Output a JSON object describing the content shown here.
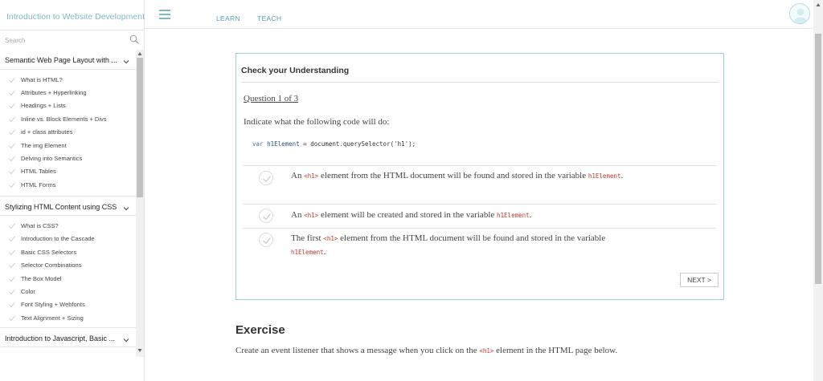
{
  "sidebar": {
    "course_title": "Introduction to Website Development",
    "search_placeholder": "Search",
    "sections": [
      {
        "title": "Semantic Web Page Layout with ...",
        "items": [
          "What is HTML?",
          "Attributes + Hyperlinking",
          "Headings + Lists",
          "Inline vs. Block Elements + Divs",
          "id + class attributes",
          "The img Element",
          "Delving into Semantics",
          "HTML Tables",
          "HTML Forms"
        ]
      },
      {
        "title": "Stylizing HTML Content using CSS",
        "items": [
          "What is CSS?",
          "Introduction to the Cascade",
          "Basic CSS Selectors",
          "Selector Combinations",
          "The Box Model",
          "Color",
          "Font Styling + Webfonts",
          "Text Alignment + Sizing"
        ]
      },
      {
        "title": "Introduction to Javascript, Basic ...",
        "items": []
      }
    ]
  },
  "topbar": {
    "learn_label": "LEARN",
    "teach_label": "TEACH"
  },
  "quiz": {
    "title": "Check your Understanding",
    "question_number": "Question 1 of 3",
    "question_text": "Indicate what the following code will do:",
    "code": {
      "kw": "var",
      "var_name": "h1Element",
      "rest": " = document.querySelector('h1');"
    },
    "options": [
      {
        "a": "An ",
        "code1": "<h1>",
        "b": " element from the HTML document will be found and stored in the variable ",
        "code2": "h1Element",
        "c": "."
      },
      {
        "a": "An ",
        "code1": "<h1>",
        "b": " element will be created and stored in the variable ",
        "code2": "h1Element",
        "c": "."
      },
      {
        "a": "The first ",
        "code1": "<h1>",
        "b": " element from the HTML document will be found and stored in the variable ",
        "code2": "h1Element",
        "c": "."
      }
    ],
    "next_label": "NEXT >"
  },
  "exercise": {
    "title": "Exercise",
    "text_before": "Create an event listener that shows a message when you click on the ",
    "code": "<h1>",
    "text_after": " element in the HTML page below."
  },
  "colors": {
    "accent": "#7fb9c2",
    "card_border": "#9cd0da",
    "code_red": "#c0392b"
  }
}
